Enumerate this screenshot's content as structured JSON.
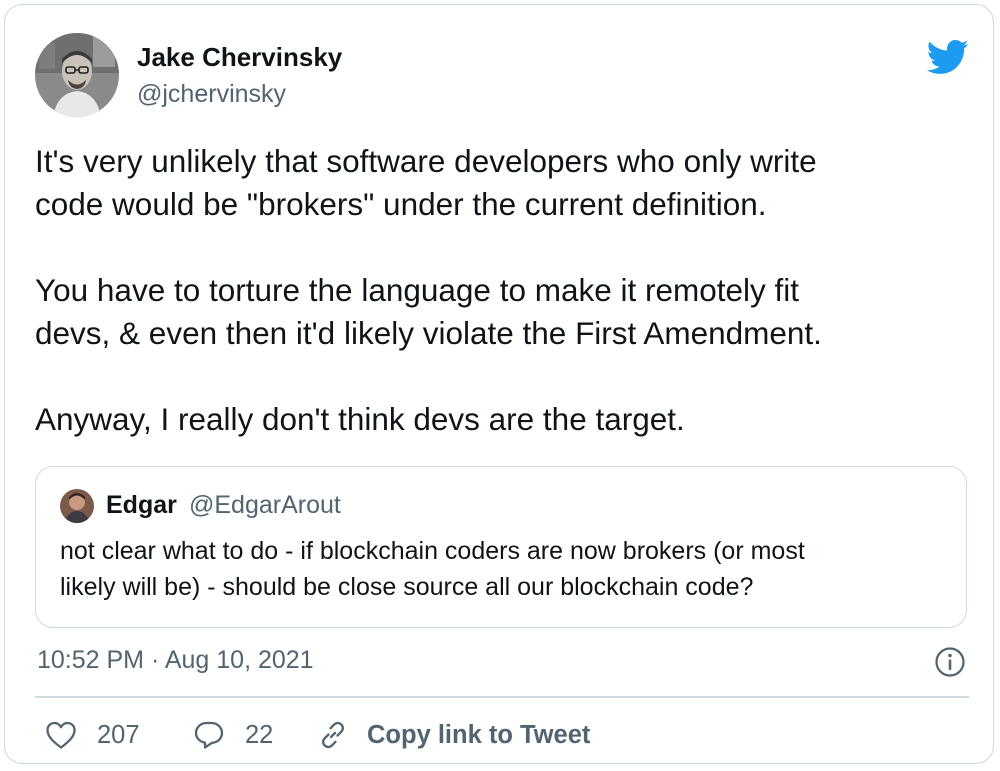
{
  "author": {
    "name": "Jake Chervinsky",
    "handle": "@jchervinsky"
  },
  "tweet": {
    "lines_p1": [
      "It's very unlikely that software developers who only write",
      "code would be \"brokers\" under the current definition."
    ],
    "lines_p2": [
      "You have to torture the language to make it remotely fit",
      "devs, & even then it'd likely violate the First Amendment."
    ],
    "lines_p3": [
      "Anyway, I really don't think devs are the target."
    ]
  },
  "quote": {
    "name": "Edgar",
    "handle": "@EdgarArout",
    "lines": [
      "not clear what to do - if blockchain coders are now brokers (or most",
      "likely will be) - should be close source all our blockchain code?"
    ]
  },
  "timestamp": "10:52 PM · Aug 10, 2021",
  "actions": {
    "like_count": "207",
    "reply_count": "22",
    "copy_link_label": "Copy link to Tweet"
  },
  "icons": {
    "brand": "twitter-bird-icon",
    "like": "heart-icon",
    "reply": "reply-bubble-icon",
    "copy": "link-icon",
    "info": "info-icon"
  },
  "colors": {
    "text": "#0f1419",
    "secondary": "#536471",
    "border": "#cfd9de",
    "brand": "#1d9bf0"
  }
}
